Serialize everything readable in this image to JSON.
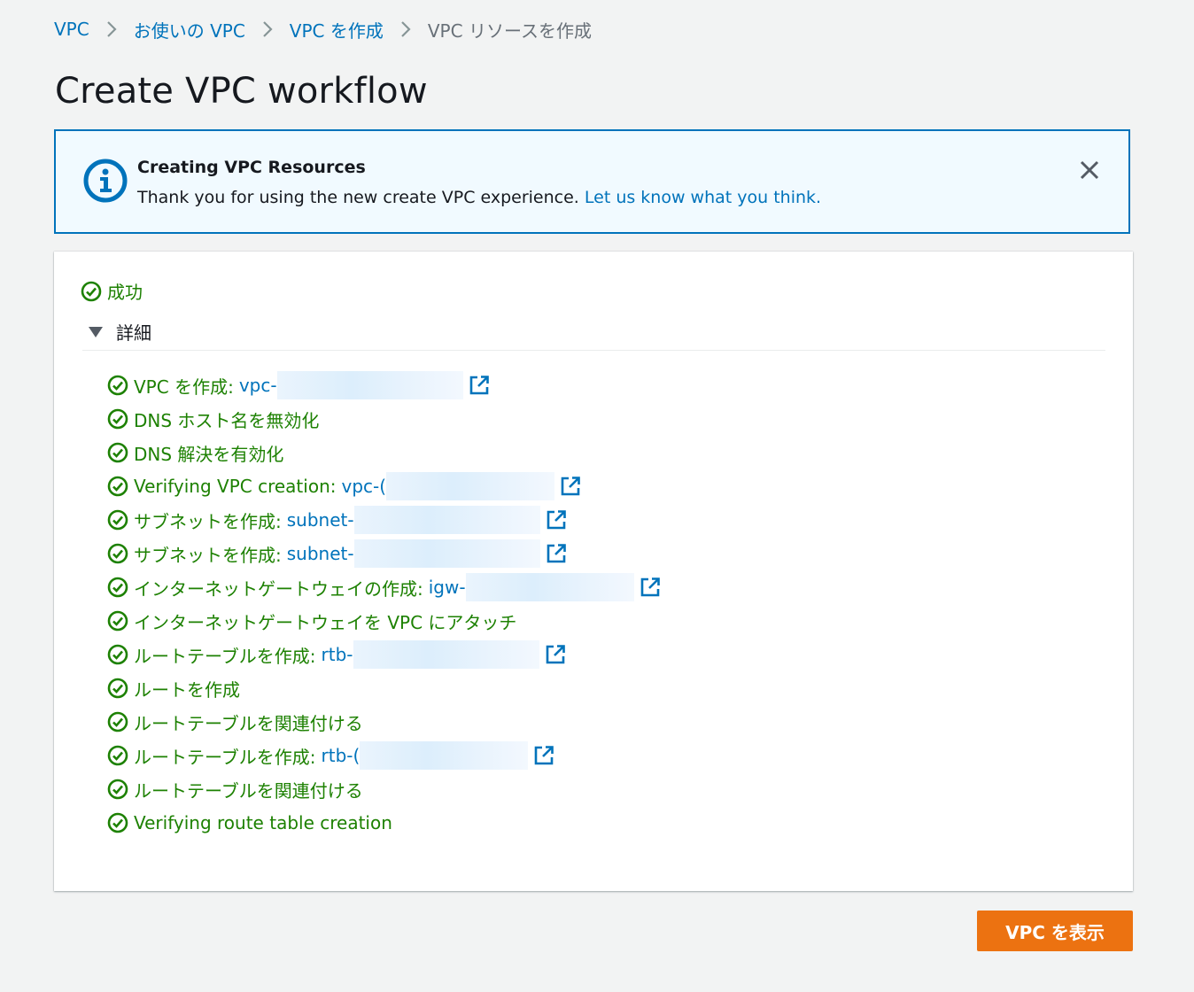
{
  "breadcrumb": {
    "items": [
      {
        "label": "VPC"
      },
      {
        "label": "お使いの VPC"
      },
      {
        "label": "VPC を作成"
      }
    ],
    "current": "VPC リソースを作成"
  },
  "page_title": "Create VPC workflow",
  "flash": {
    "title": "Creating VPC Resources",
    "message": "Thank you for using the new create VPC experience.",
    "link": "Let us know what you think."
  },
  "status": {
    "label": "成功",
    "color": "#1d8102"
  },
  "details": {
    "label": "詳細",
    "steps": [
      {
        "text": "VPC を作成:",
        "link_prefix": "vpc-"
      },
      {
        "text": "DNS ホスト名を無効化"
      },
      {
        "text": "DNS 解決を有効化"
      },
      {
        "text": "Verifying VPC creation:",
        "link_prefix": "vpc-("
      },
      {
        "text": "サブネットを作成:",
        "link_prefix": "subnet-"
      },
      {
        "text": "サブネットを作成:",
        "link_prefix": "subnet-"
      },
      {
        "text": "インターネットゲートウェイの作成:",
        "link_prefix": "igw-"
      },
      {
        "text": "インターネットゲートウェイを VPC にアタッチ"
      },
      {
        "text": "ルートテーブルを作成:",
        "link_prefix": "rtb-"
      },
      {
        "text": "ルートを作成"
      },
      {
        "text": "ルートテーブルを関連付ける"
      },
      {
        "text": "ルートテーブルを作成:",
        "link_prefix": "rtb-("
      },
      {
        "text": "ルートテーブルを関連付ける"
      },
      {
        "text": "Verifying route table creation"
      }
    ]
  },
  "primary_button": {
    "label": "VPC を表示",
    "color": "#ec7211"
  },
  "colors": {
    "link": "#0073bb",
    "success": "#1d8102",
    "info_border": "#0073bb"
  }
}
